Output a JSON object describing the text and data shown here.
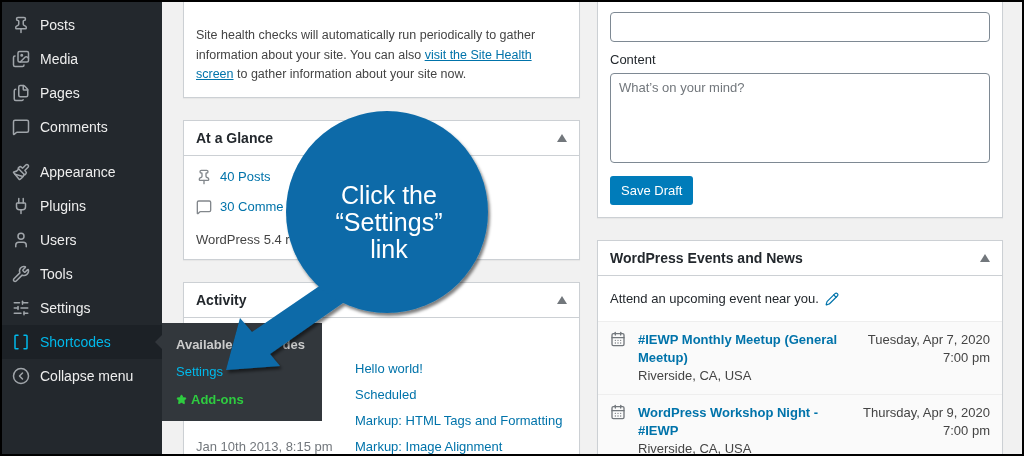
{
  "sidebar": {
    "items": [
      {
        "label": "Posts",
        "selected": false
      },
      {
        "label": "Media",
        "selected": false
      },
      {
        "label": "Pages",
        "selected": false
      },
      {
        "label": "Comments",
        "selected": false
      },
      {
        "label": "Appearance",
        "selected": false
      },
      {
        "label": "Plugins",
        "selected": false
      },
      {
        "label": "Users",
        "selected": false
      },
      {
        "label": "Tools",
        "selected": false
      },
      {
        "label": "Settings",
        "selected": false
      },
      {
        "label": "Shortcodes",
        "selected": true
      },
      {
        "label": "Collapse menu",
        "selected": false
      }
    ],
    "flyout": {
      "items": [
        {
          "kind": "header",
          "parts": [
            "Available",
            "des"
          ]
        },
        {
          "kind": "link",
          "label": "Settings"
        },
        {
          "kind": "addon",
          "label": "Add-ons"
        }
      ]
    }
  },
  "site_health": {
    "text_before": "Site health checks will automatically run periodically to gather information about your site. You can also ",
    "links": [
      "visit the Site Health",
      "screen"
    ],
    "text_after": " to gather information about your site now."
  },
  "at_a_glance": {
    "title": "At a Glance",
    "items": [
      "40 Posts",
      "30 Comme"
    ],
    "version": "WordPress 5.4 r"
  },
  "activity": {
    "title": "Activity",
    "rows": [
      {
        "title": "Hello world!"
      },
      {
        "title": "Scheduled"
      },
      {
        "title": "Markup: HTML Tags and Formatting"
      },
      {
        "date": "Jan 10th 2013, 8:15 pm",
        "title": "Markup: Image Alignment"
      }
    ]
  },
  "quick_draft": {
    "content_label": "Content",
    "content_placeholder": "What’s on your mind?",
    "button": "Save Draft"
  },
  "events": {
    "title": "WordPress Events and News",
    "intro": "Attend an upcoming event near you.",
    "items": [
      {
        "title": "#IEWP Monthly Meetup (General Meetup)",
        "location": "Riverside, CA, USA",
        "date": "Tuesday, Apr 7, 2020",
        "time": "7:00 pm"
      },
      {
        "title": "WordPress Workshop Night - #IEWP",
        "location": "Riverside, CA, USA",
        "date": "Thursday, Apr 9, 2020",
        "time": "7:00 pm"
      }
    ]
  },
  "callout": {
    "lines": [
      "Click the",
      "“Settings”",
      "link"
    ]
  }
}
